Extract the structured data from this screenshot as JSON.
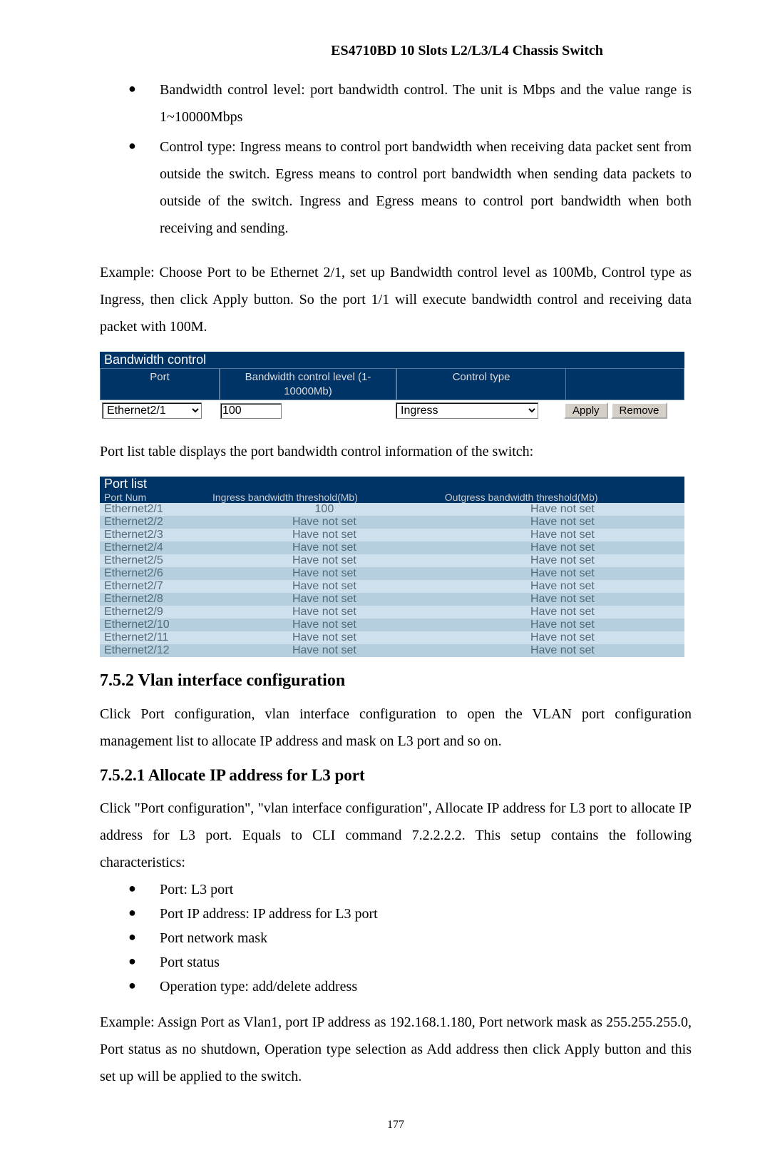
{
  "header": "ES4710BD 10 Slots L2/L3/L4 Chassis Switch",
  "bullets_top": [
    "Bandwidth control level: port bandwidth control. The unit is Mbps and the value range is 1~10000Mbps",
    "Control type: Ingress means to control port bandwidth when receiving data packet sent from outside the switch. Egress means to control port bandwidth when sending data packets to outside of the switch. Ingress and Egress means to control port bandwidth when both receiving and sending."
  ],
  "example1": "Example: Choose Port to be Ethernet 2/1, set up Bandwidth control level as 100Mb, Control type as Ingress, then click Apply button. So the port 1/1 will execute bandwidth control and receiving data packet with 100M.",
  "band": {
    "title": "Bandwidth control",
    "col_port": "Port",
    "col_level": "Bandwidth control level (1-10000Mb)",
    "col_ctype": "Control type",
    "port_value": "Ethernet2/1",
    "level_value": "100",
    "ctype_value": "Ingress",
    "apply": "Apply",
    "remove": "Remove"
  },
  "portlist_intro": "Port list table displays the port bandwidth control information of the switch:",
  "portlist": {
    "title": "Port list",
    "col_port": "Port Num",
    "col_in": "Ingress bandwidth threshold(Mb)",
    "col_out": "Outgress bandwidth threshold(Mb)",
    "rows": [
      {
        "p": "Ethernet2/1",
        "i": "100",
        "o": "Have not set"
      },
      {
        "p": "Ethernet2/2",
        "i": "Have not set",
        "o": "Have not set"
      },
      {
        "p": "Ethernet2/3",
        "i": "Have not set",
        "o": "Have not set"
      },
      {
        "p": "Ethernet2/4",
        "i": "Have not set",
        "o": "Have not set"
      },
      {
        "p": "Ethernet2/5",
        "i": "Have not set",
        "o": "Have not set"
      },
      {
        "p": "Ethernet2/6",
        "i": "Have not set",
        "o": "Have not set"
      },
      {
        "p": "Ethernet2/7",
        "i": "Have not set",
        "o": "Have not set"
      },
      {
        "p": "Ethernet2/8",
        "i": "Have not set",
        "o": "Have not set"
      },
      {
        "p": "Ethernet2/9",
        "i": "Have not set",
        "o": "Have not set"
      },
      {
        "p": "Ethernet2/10",
        "i": "Have not set",
        "o": "Have not set"
      },
      {
        "p": "Ethernet2/11",
        "i": "Have not set",
        "o": "Have not set"
      },
      {
        "p": "Ethernet2/12",
        "i": "Have not set",
        "o": "Have not set"
      }
    ]
  },
  "sec752": "7.5.2    Vlan interface configuration",
  "p752": "Click Port configuration, vlan interface configuration to open the VLAN port configuration management list to allocate IP address and mask on L3 port and so on.",
  "sec7521": "7.5.2.1    Allocate IP address for L3 port",
  "p7521": "Click \"Port configuration\", \"vlan interface configuration\", Allocate IP address for L3 port to allocate IP address for L3 port. Equals to CLI command 7.2.2.2.2.  This setup contains the following characteristics:",
  "bullets_mid": [
    "Port: L3 port",
    "Port IP address: IP address for L3 port",
    "Port network mask",
    "Port status",
    "Operation type: add/delete address"
  ],
  "example2": "Example: Assign Port as Vlan1, port IP address as 192.168.1.180, Port network mask as 255.255.255.0, Port status as no shutdown, Operation type selection as Add address then click Apply button and this set up will be applied to the switch.",
  "page_number": "177"
}
